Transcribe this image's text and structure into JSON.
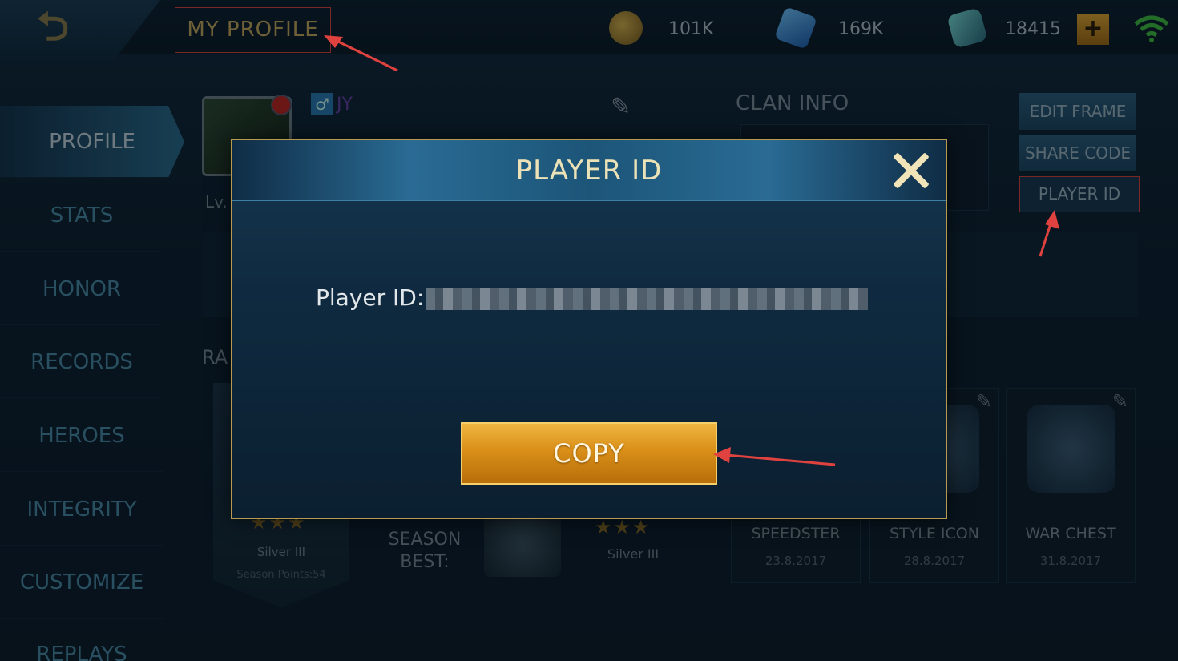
{
  "header": {
    "title": "MY PROFILE",
    "currencies": [
      {
        "icon": "gold-coin-icon",
        "amount": "101K"
      },
      {
        "icon": "gem-icon",
        "amount": "169K"
      },
      {
        "icon": "voucher-icon",
        "amount": "18415"
      }
    ],
    "plus_label": "+"
  },
  "sidebar": {
    "items": [
      {
        "label": "PROFILE",
        "active": true
      },
      {
        "label": "STATS"
      },
      {
        "label": "HONOR"
      },
      {
        "label": "RECORDS"
      },
      {
        "label": "HEROES"
      },
      {
        "label": "INTEGRITY"
      },
      {
        "label": "CUSTOMIZE"
      },
      {
        "label": "REPLAYS"
      }
    ]
  },
  "profile": {
    "gender_symbol": "♂",
    "name": "JY",
    "level_prefix": "Lv.",
    "clan_title": "CLAN INFO",
    "buttons": {
      "edit_frame": "EDIT FRAME",
      "share_code": "SHARE CODE",
      "player_id": "PLAYER ID"
    },
    "rank_heading": "RA",
    "rank": {
      "name": "Silver III",
      "points": "Season Points:54",
      "stars": "★★★"
    },
    "season_best": {
      "label": "SEASON BEST:",
      "rank": "Silver III",
      "stars": "★★★"
    },
    "achievements": [
      {
        "label": "SPEEDSTER",
        "date": "23.8.2017"
      },
      {
        "label": "STYLE ICON",
        "date": "28.8.2017"
      },
      {
        "label": "WAR CHEST",
        "date": "31.8.2017"
      }
    ]
  },
  "modal": {
    "title": "PLAYER ID",
    "id_label": "Player ID:",
    "copy_label": "COPY"
  },
  "colors": {
    "accent_gold": "#d98f18",
    "annotation_red": "#e0433f"
  }
}
